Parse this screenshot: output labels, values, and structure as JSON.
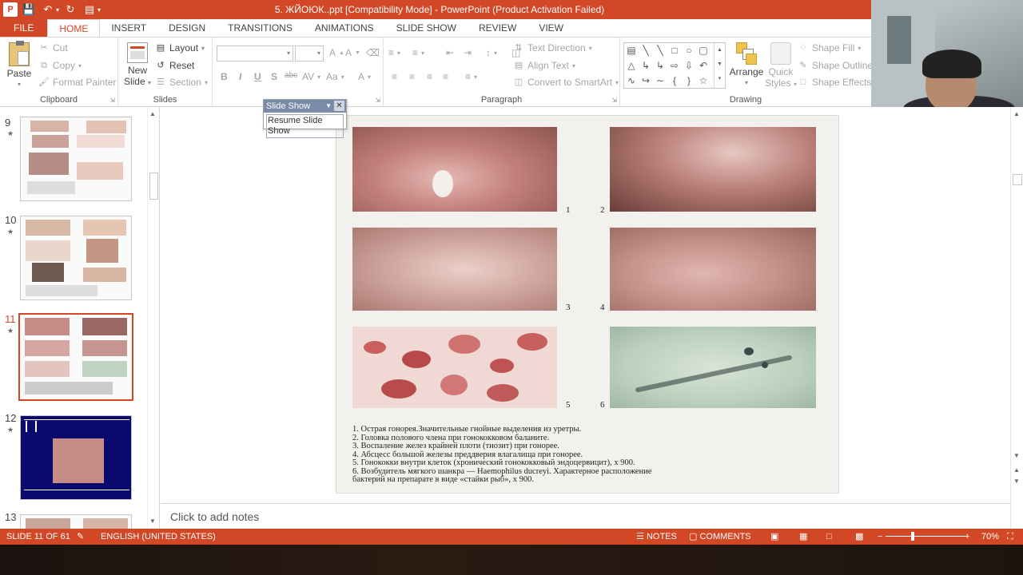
{
  "window": {
    "title": "5. ЖЙОЮК..ppt [Compatibility Mode] -  PowerPoint (Product Activation Failed)",
    "app_icon": "P"
  },
  "colors": {
    "accent": "#d24726",
    "popup_header": "#7a8ba8"
  },
  "tabs": [
    {
      "label": "FILE"
    },
    {
      "label": "HOME"
    },
    {
      "label": "INSERT"
    },
    {
      "label": "DESIGN"
    },
    {
      "label": "TRANSITIONS"
    },
    {
      "label": "ANIMATIONS"
    },
    {
      "label": "SLIDE SHOW"
    },
    {
      "label": "REVIEW"
    },
    {
      "label": "VIEW"
    }
  ],
  "ribbon": {
    "clipboard": {
      "label": "Clipboard",
      "paste": "Paste",
      "cut": "Cut",
      "copy": "Copy",
      "format_painter": "Format Painter"
    },
    "slides": {
      "label": "Slides",
      "new_slide_1": "New",
      "new_slide_2": "Slide",
      "layout": "Layout",
      "reset": "Reset",
      "section": "Section"
    },
    "font": {
      "bold": "B",
      "italic": "I",
      "underline": "U",
      "shadow": "S",
      "strike": "abc"
    },
    "paragraph": {
      "label": "Paragraph",
      "text_direction": "Text Direction",
      "align_text": "Align Text",
      "convert_smartart": "Convert to SmartArt"
    },
    "drawing": {
      "label": "Drawing",
      "arrange": "Arrange",
      "quick_styles_1": "Quick",
      "quick_styles_2": "Styles",
      "shape_fill": "Shape Fill",
      "shape_outline": "Shape Outline",
      "shape_effects": "Shape Effects"
    }
  },
  "slide_show_popup": {
    "title": "Slide Show",
    "resume": "Resume Slide Show"
  },
  "thumbnails": [
    {
      "number": "9"
    },
    {
      "number": "10"
    },
    {
      "number": "11"
    },
    {
      "number": "12"
    },
    {
      "number": "13"
    }
  ],
  "slide": {
    "photo_numbers": [
      "1",
      "2",
      "3",
      "4",
      "5",
      "6"
    ],
    "caption_lines": [
      "1. Острая гонорея.Значительные гнойные выделения из уретры.",
      "2. Головка полового члена при гонококковом баланите.",
      "3. Воспаление желез крайней плоти (тиозит) при   гонорее.",
      "4. Абсцесс большой железы преддверия влагалища при гонорее.",
      "5. Гонококки внутри клеток (хронический гонококковый эндоцервицит), x 900.",
      "6. Возбудитель мягкого шанкра — Haemophilus ducreyi. Характерное расположение",
      "    бактерий на препарате в виде «стайки рыб», x 900."
    ]
  },
  "notes": {
    "placeholder": "Click to add notes"
  },
  "status": {
    "slide_count": "SLIDE 11 OF 61",
    "language": "ENGLISH (UNITED STATES)",
    "notes": "NOTES",
    "comments": "COMMENTS",
    "zoom": "70%"
  }
}
